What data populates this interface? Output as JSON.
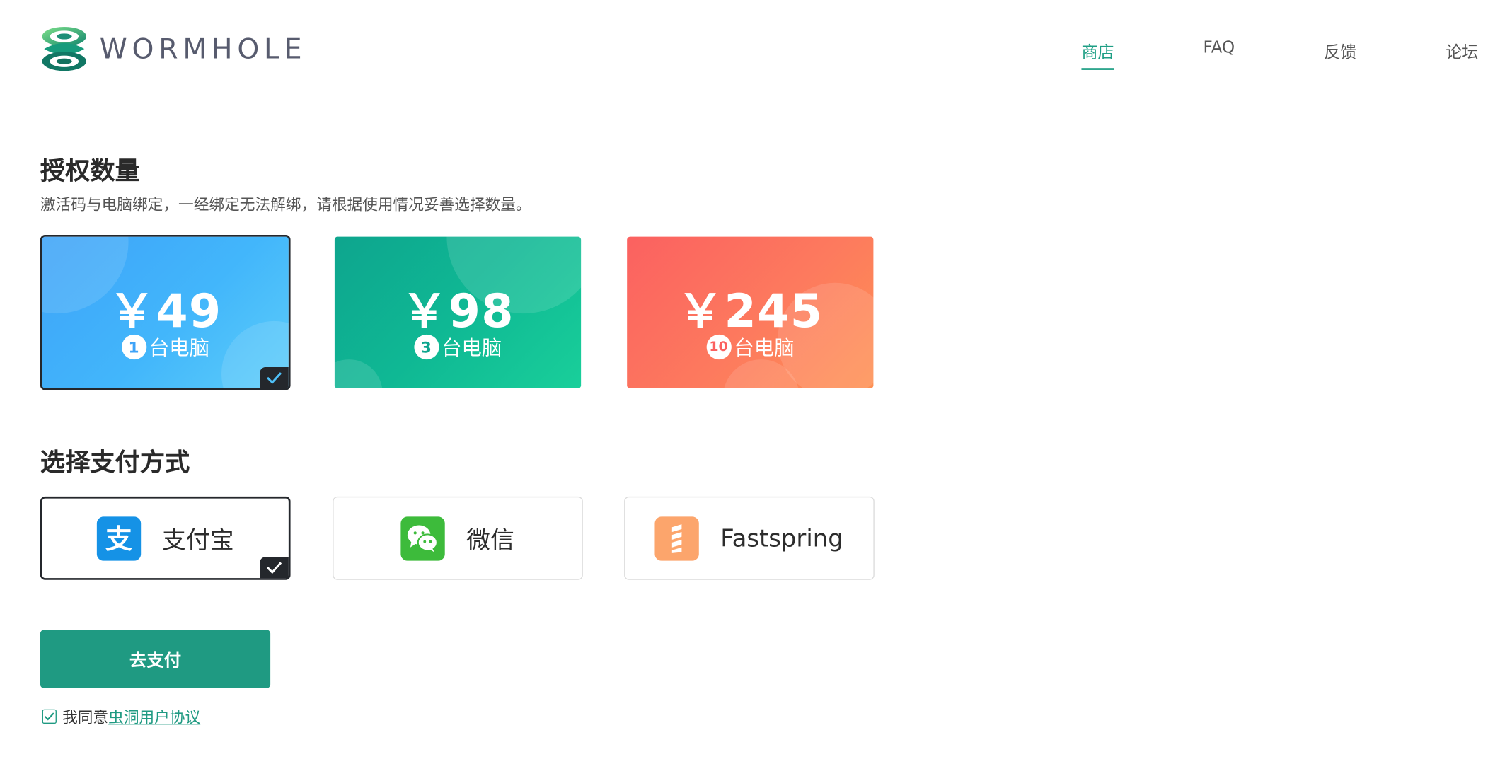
{
  "brand": {
    "name": "WORMHOLE",
    "logo_icon": "wormhole-logo-icon",
    "accent_color": "#1d9e84"
  },
  "nav": {
    "items": [
      {
        "label": "商店",
        "active": true
      },
      {
        "label": "FAQ",
        "active": false
      },
      {
        "label": "反馈",
        "active": false
      },
      {
        "label": "论坛",
        "active": false
      }
    ]
  },
  "license": {
    "title": "授权数量",
    "description": "激活码与电脑绑定，一经绑定无法解绑，请根据使用情况妥善选择数量。",
    "options": [
      {
        "price": "￥49",
        "count": "1",
        "unit": "台电脑",
        "color": "#3ea3f8",
        "selected": true
      },
      {
        "price": "￥98",
        "count": "3",
        "unit": "台电脑",
        "color": "#0ea58e",
        "selected": false
      },
      {
        "price": "￥245",
        "count": "10",
        "unit": "台电脑",
        "color": "#fb6160",
        "selected": false
      }
    ]
  },
  "payment": {
    "title": "选择支付方式",
    "methods": [
      {
        "label": "支付宝",
        "icon": "alipay-icon",
        "color": "#1592e6",
        "selected": true
      },
      {
        "label": "微信",
        "icon": "wechat-icon",
        "color": "#3dbb3b",
        "selected": false
      },
      {
        "label": "Fastspring",
        "icon": "fastspring-icon",
        "color": "#fca56c",
        "selected": false
      }
    ]
  },
  "checkout": {
    "pay_button_label": "去支付",
    "agree_prefix": "我同意",
    "agree_link": "虫洞用户协议",
    "agreed": true
  }
}
